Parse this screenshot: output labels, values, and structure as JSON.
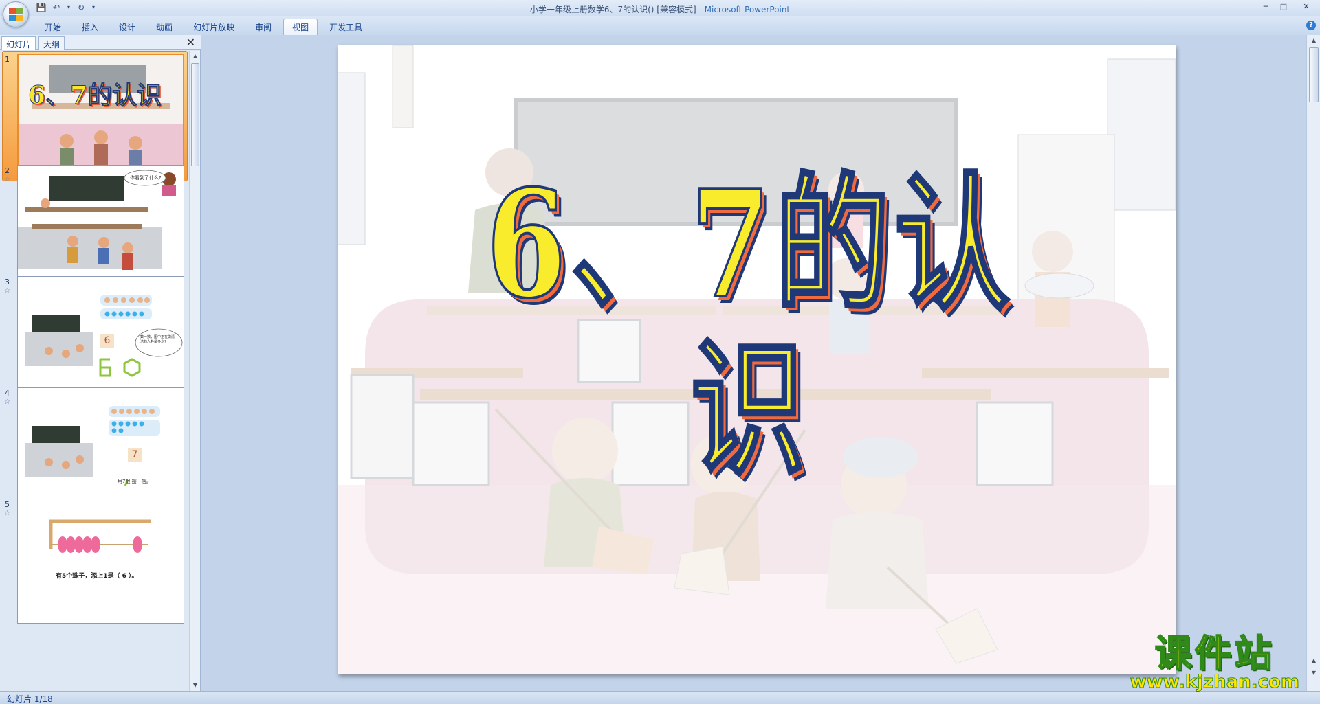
{
  "window": {
    "title_doc": "小学一年级上册数学6、7的认识() [兼容模式]",
    "title_sep": " - ",
    "title_app": "Microsoft PowerPoint"
  },
  "ribbon": {
    "tabs": [
      {
        "label": "开始"
      },
      {
        "label": "插入"
      },
      {
        "label": "设计"
      },
      {
        "label": "动画"
      },
      {
        "label": "幻灯片放映"
      },
      {
        "label": "审阅"
      },
      {
        "label": "视图",
        "active": true
      },
      {
        "label": "开发工具"
      }
    ]
  },
  "panel": {
    "tab_slides": "幻灯片",
    "tab_outline": "大纲",
    "slides": [
      {
        "num": "1",
        "title": "6、7的认识",
        "selected": true
      },
      {
        "num": "2",
        "bubble": "你看到了什么?"
      },
      {
        "num": "3",
        "digit": "6",
        "bubble": "数一数，图中正在做清洁的人各是多少?"
      },
      {
        "num": "4",
        "digit": "7",
        "caption": "用7根 摆一摆。"
      },
      {
        "num": "5",
        "caption": "有5个珠子，添上1是（ 6 ）。"
      }
    ]
  },
  "slide": {
    "title": "6、7的认识"
  },
  "status": {
    "text": "幻灯片 1/18"
  },
  "watermark": {
    "big": "课件站",
    "small": "www.kjzhan.com"
  }
}
